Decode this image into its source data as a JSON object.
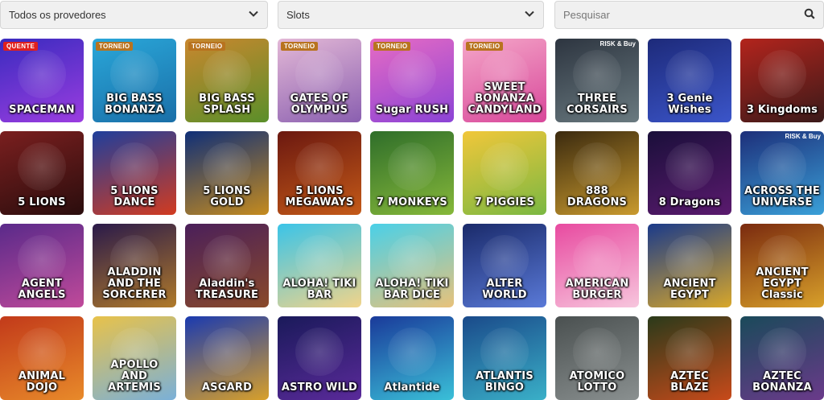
{
  "filters": {
    "provider": "Todos os provedores",
    "category": "Slots",
    "search_placeholder": "Pesquisar",
    "chevron_icon": "chevron-down-icon",
    "search_icon": "search-icon"
  },
  "games": [
    {
      "title": "SPACEMAN",
      "badge": "QUENTE",
      "bg1": "#3a2bbf",
      "bg2": "#9b3de0"
    },
    {
      "title": "BIG BASS BONANZA",
      "badge": "TORNEIO",
      "bg1": "#2aa7d9",
      "bg2": "#1a6fa8"
    },
    {
      "title": "BIG BASS SPLASH",
      "badge": "TORNEIO",
      "bg1": "#c9872e",
      "bg2": "#5a8f2a"
    },
    {
      "title": "GATES OF OLYMPUS",
      "badge": "TORNEIO",
      "bg1": "#e3b8d6",
      "bg2": "#8a5fb0"
    },
    {
      "title": "Sugar RUSH",
      "badge": "TORNEIO",
      "bg1": "#e66bc4",
      "bg2": "#8b43d6"
    },
    {
      "title": "SWEET BONANZA CANDYLAND",
      "badge": "TORNEIO",
      "bg1": "#f4a6c8",
      "bg2": "#d8479a"
    },
    {
      "title": "THREE CORSAIRS",
      "badge_r": "RISK & Buy",
      "bg1": "#2d3540",
      "bg2": "#6a7a80"
    },
    {
      "title": "3 Genie Wishes",
      "bg1": "#1d2a7a",
      "bg2": "#3b55c9"
    },
    {
      "title": "3 Kingdoms",
      "bg1": "#b3241c",
      "bg2": "#3a1a1a"
    },
    {
      "title": "5 LIONS",
      "bg1": "#7a1f1f",
      "bg2": "#2a0d0d"
    },
    {
      "title": "5 LIONS DANCE",
      "bg1": "#1f3f9c",
      "bg2": "#d23b20"
    },
    {
      "title": "5 LIONS GOLD",
      "bg1": "#0f2f78",
      "bg2": "#c58b1e"
    },
    {
      "title": "5 LIONS MEGAWAYS",
      "bg1": "#6b1810",
      "bg2": "#c45a18"
    },
    {
      "title": "7 MONKEYS",
      "bg1": "#2f6e2a",
      "bg2": "#86b83a"
    },
    {
      "title": "7 PIGGIES",
      "bg1": "#f1c73a",
      "bg2": "#7ab842"
    },
    {
      "title": "888 DRAGONS",
      "bg1": "#3b2a0f",
      "bg2": "#c99a2e"
    },
    {
      "title": "8 Dragons",
      "bg1": "#1a0f3a",
      "bg2": "#5a1a6e"
    },
    {
      "title": "ACROSS THE UNIVERSE",
      "badge_r": "RISK & Buy",
      "bg1": "#1d2f7a",
      "bg2": "#3aa0d8"
    },
    {
      "title": "AGENT ANGELS",
      "bg1": "#5a2a8a",
      "bg2": "#c04a9a"
    },
    {
      "title": "ALADDIN AND THE SORCERER",
      "bg1": "#2a1a4a",
      "bg2": "#b07a2a"
    },
    {
      "title": "Aladdin's TREASURE",
      "bg1": "#4a1f5a",
      "bg2": "#8a4a2a"
    },
    {
      "title": "ALOHA! TIKI BAR",
      "bg1": "#3ac4e8",
      "bg2": "#f1d48a"
    },
    {
      "title": "ALOHA! TIKI BAR DICE",
      "bg1": "#4ad0e8",
      "bg2": "#e8c27a"
    },
    {
      "title": "ALTER WORLD",
      "bg1": "#1a2a6a",
      "bg2": "#5a7ad8"
    },
    {
      "title": "AMERICAN BURGER",
      "bg1": "#e84aa0",
      "bg2": "#f7c6dd"
    },
    {
      "title": "ANCIENT EGYPT",
      "bg1": "#1a3a8a",
      "bg2": "#d8a72a"
    },
    {
      "title": "ANCIENT EGYPT Classic",
      "bg1": "#7a2a0f",
      "bg2": "#d8a02a"
    },
    {
      "title": "ANIMAL DOJO",
      "bg1": "#c23a1a",
      "bg2": "#e88a2a"
    },
    {
      "title": "APOLLO AND ARTEMIS",
      "bg1": "#e8c24a",
      "bg2": "#7ab0d8"
    },
    {
      "title": "ASGARD",
      "bg1": "#1a3ab0",
      "bg2": "#d8a02a"
    },
    {
      "title": "ASTRO WILD",
      "bg1": "#1a1a5a",
      "bg2": "#5a2a9a"
    },
    {
      "title": "Atlantide",
      "bg1": "#1a3a9a",
      "bg2": "#3ac0d8"
    },
    {
      "title": "ATLANTIS BINGO",
      "bg1": "#1a4a8a",
      "bg2": "#3ab0c8"
    },
    {
      "title": "ATOMICO LOTTO",
      "bg1": "#4a5050",
      "bg2": "#8a9090"
    },
    {
      "title": "AZTEC BLAZE",
      "bg1": "#2a3a1a",
      "bg2": "#c84a1a"
    },
    {
      "title": "AZTEC BONANZA",
      "bg1": "#1a4a5a",
      "bg2": "#6a3a8a"
    }
  ]
}
